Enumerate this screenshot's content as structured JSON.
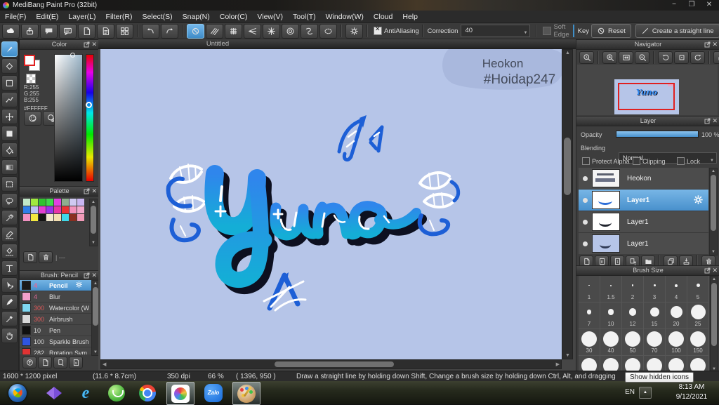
{
  "window": {
    "title": "MediBang Paint Pro (32bit)",
    "controls": {
      "minimize": "−",
      "restore": "❐",
      "close": "✕"
    }
  },
  "menu": {
    "items": [
      "File(F)",
      "Edit(E)",
      "Layer(L)",
      "Filter(R)",
      "Select(S)",
      "Snap(N)",
      "Color(C)",
      "View(V)",
      "Tool(T)",
      "Window(W)",
      "Cloud",
      "Help"
    ]
  },
  "toolbar": {
    "file_icons": [
      {
        "name": "cloud"
      },
      {
        "name": "publish"
      },
      {
        "name": "comment"
      },
      {
        "name": "chat"
      },
      {
        "name": "document"
      },
      {
        "name": "document-list"
      },
      {
        "name": "tiles"
      }
    ],
    "history_icons": [
      {
        "name": "undo"
      },
      {
        "name": "redo"
      }
    ],
    "snap_icons": [
      {
        "name": "snap-off",
        "selected": true
      },
      {
        "name": "snap-parallel"
      },
      {
        "name": "snap-grid"
      },
      {
        "name": "snap-vanishing"
      },
      {
        "name": "snap-radial"
      },
      {
        "name": "snap-concentric"
      },
      {
        "name": "snap-curve"
      },
      {
        "name": "snap-ellipse"
      }
    ],
    "settings_icons": [
      {
        "name": "snap-settings"
      }
    ],
    "antialiasing_label": "AntiAliasing",
    "correction_label": "Correction",
    "correction_value": "40",
    "soft_edge_label": "Soft Edge",
    "key_label": "Key",
    "reset_label": "Reset",
    "straight_line_label": "Create a straight line"
  },
  "tool_strip": {
    "tools": [
      {
        "name": "brush",
        "selected": true
      },
      {
        "name": "eraser"
      },
      {
        "name": "frame"
      },
      {
        "name": "polyline"
      },
      {
        "name": "move"
      },
      {
        "name": "fill-rect"
      },
      {
        "name": "bucket"
      },
      {
        "name": "gradient"
      },
      {
        "name": "select-rect"
      },
      {
        "name": "lasso"
      },
      {
        "name": "magic-wand"
      },
      {
        "name": "select-pen"
      },
      {
        "name": "select-eraser"
      },
      {
        "name": "text"
      },
      {
        "name": "transform"
      },
      {
        "name": "pen"
      },
      {
        "name": "eyedropper"
      },
      {
        "name": "hand"
      }
    ]
  },
  "color_panel": {
    "title": "Color",
    "r": "R:255",
    "g": "G:255",
    "b": "B:255",
    "hex": "#FFFFFF",
    "buttons": [
      {
        "name": "color-palette"
      },
      {
        "name": "color-palette-edit"
      }
    ]
  },
  "palette_panel": {
    "title": "Palette",
    "footer_icons": [
      {
        "name": "add-color"
      },
      {
        "name": "delete-color"
      }
    ],
    "footer_text": "| ---",
    "colors": [
      "#c2e8c8",
      "#a0e83f",
      "#2fc42f",
      "#3fd94a",
      "#e23fe2",
      "#8fae8f",
      "#cfc9f2",
      "#c9b6f2",
      "#2f7fe8",
      "#b9c2f2",
      "#e23fd0",
      "#9a33e8",
      "#e833a8",
      "#e83333",
      "#f292bc",
      "#f2a8cc",
      "#f292c2",
      "#f2e83f",
      "#141414",
      "#f2e8cc",
      "#f2ddb0",
      "#3fd8e8",
      "#8a2f20",
      "#f29ab8"
    ]
  },
  "brush_panel": {
    "title": "Brush: Pencil",
    "brushes": [
      {
        "size": "4",
        "name": "Pencil",
        "swatch": "#1a1a1a",
        "size_color": "#e06898",
        "selected": true
      },
      {
        "size": "4",
        "name": "Blur",
        "swatch": "#f2a0cc",
        "size_color": "#e06898",
        "selected": false
      },
      {
        "size": "300",
        "name": "Watercolor (W",
        "swatch": "#7fd8f2",
        "size_color": "#e05858",
        "selected": false
      },
      {
        "size": "300",
        "name": "Airbrush",
        "swatch": "#d8d8d8",
        "size_color": "#e05858",
        "selected": false
      },
      {
        "size": "10",
        "name": "Pen",
        "swatch": "#101010",
        "size_color": "#d8d8d8",
        "selected": false
      },
      {
        "size": "100",
        "name": "Sparkle Brush",
        "swatch": "#2f55e0",
        "size_color": "#d8d8d8",
        "selected": false
      },
      {
        "size": "282",
        "name": "Rotation Sym",
        "swatch": "#e03333",
        "size_color": "#d8d8d8",
        "selected": false
      }
    ],
    "footer_icons": [
      {
        "name": "upload-brush"
      },
      {
        "name": "add-brush"
      },
      {
        "name": "add-brush-menu"
      },
      {
        "name": "brush-script"
      }
    ]
  },
  "canvas": {
    "tab_title": "Untitled",
    "background": "#b6c5e8",
    "annotation_line1": "Heokon",
    "annotation_line2": "#Hoidap247",
    "art_text": "Yuno",
    "art_colors": {
      "blue": "#1d5fd6",
      "gradient_top": "#2f86ec",
      "gradient_bottom": "#14aed6",
      "shadow": "#0d1020",
      "highlight": "#ffffff"
    }
  },
  "navigator": {
    "title": "Navigator",
    "icons": [
      {
        "name": "zoom-actual"
      },
      {
        "name": "divider"
      },
      {
        "name": "zoom-in"
      },
      {
        "name": "fit-window"
      },
      {
        "name": "zoom-out"
      },
      {
        "name": "divider"
      },
      {
        "name": "rotate-left"
      },
      {
        "name": "rotate-reset"
      },
      {
        "name": "rotate-right"
      },
      {
        "name": "divider"
      },
      {
        "name": "view-lock"
      }
    ]
  },
  "layer_panel": {
    "title": "Layer",
    "opacity_label": "Opacity",
    "opacity_value": "100 %",
    "blending_label": "Blending",
    "blending_value": "Normal",
    "protect_alpha_label": "Protect Alpha",
    "clipping_label": "Clipping",
    "lock_label": "Lock",
    "layers": [
      {
        "name": "Heokon",
        "thumb": "thumb-heokon",
        "selected": false
      },
      {
        "name": "Layer1",
        "thumb": "thumb-sketch-blue",
        "selected": true
      },
      {
        "name": "Layer1",
        "thumb": "thumb-sketch-dark",
        "selected": false
      },
      {
        "name": "Layer1",
        "thumb": "thumb-solid-blue",
        "selected": false
      }
    ],
    "footer_icons": [
      {
        "name": "add-layer"
      },
      {
        "name": "add-8bit-layer"
      },
      {
        "name": "add-1bit-layer"
      },
      {
        "name": "add-layer-menu"
      },
      {
        "name": "layer-folder"
      },
      {
        "name": "divider"
      },
      {
        "name": "duplicate-layer"
      },
      {
        "name": "merge-layer"
      },
      {
        "name": "divider"
      },
      {
        "name": "delete-layer"
      }
    ]
  },
  "brush_size_panel": {
    "title": "Brush Size",
    "sizes": [
      {
        "label": "1",
        "dot": 1.5
      },
      {
        "label": "1.5",
        "dot": 2
      },
      {
        "label": "2",
        "dot": 2.5
      },
      {
        "label": "3",
        "dot": 3
      },
      {
        "label": "4",
        "dot": 4
      },
      {
        "label": "5",
        "dot": 5
      },
      {
        "label": "7",
        "dot": 6.5
      },
      {
        "label": "10",
        "dot": 8.5
      },
      {
        "label": "12",
        "dot": 10.5
      },
      {
        "label": "15",
        "dot": 13
      },
      {
        "label": "20",
        "dot": 17
      },
      {
        "label": "25",
        "dot": 21
      },
      {
        "label": "30",
        "dot": 22
      },
      {
        "label": "40",
        "dot": 22
      },
      {
        "label": "50",
        "dot": 22
      },
      {
        "label": "70",
        "dot": 22
      },
      {
        "label": "100",
        "dot": 22
      },
      {
        "label": "150",
        "dot": 22
      },
      {
        "label": "",
        "dot": 22
      },
      {
        "label": "",
        "dot": 22
      },
      {
        "label": "",
        "dot": 22
      },
      {
        "label": "",
        "dot": 22
      },
      {
        "label": "",
        "dot": 22
      },
      {
        "label": "",
        "dot": 22
      }
    ]
  },
  "status_bar": {
    "size": "1600 * 1200 pixel",
    "physical": "(11.6 * 8.7cm)",
    "dpi": "350 dpi",
    "zoom": "66 %",
    "coords": "( 1396, 950 )",
    "hint": "Draw a straight line by holding down Shift, Change a brush size by holding down Ctrl, Alt, and dragging"
  },
  "taskbar": {
    "apps": [
      {
        "name": "start"
      },
      {
        "name": "kmplayer"
      },
      {
        "name": "internet-explorer"
      },
      {
        "name": "coc-coc"
      },
      {
        "name": "chrome"
      },
      {
        "name": "medibang-paint",
        "active": true
      },
      {
        "name": "zalo"
      },
      {
        "name": "paint",
        "active": true
      }
    ],
    "zalo_label": "Zalo",
    "language": "EN",
    "time": "8:13 AM",
    "date": "9/12/2021",
    "tooltip": "Show hidden icons"
  }
}
